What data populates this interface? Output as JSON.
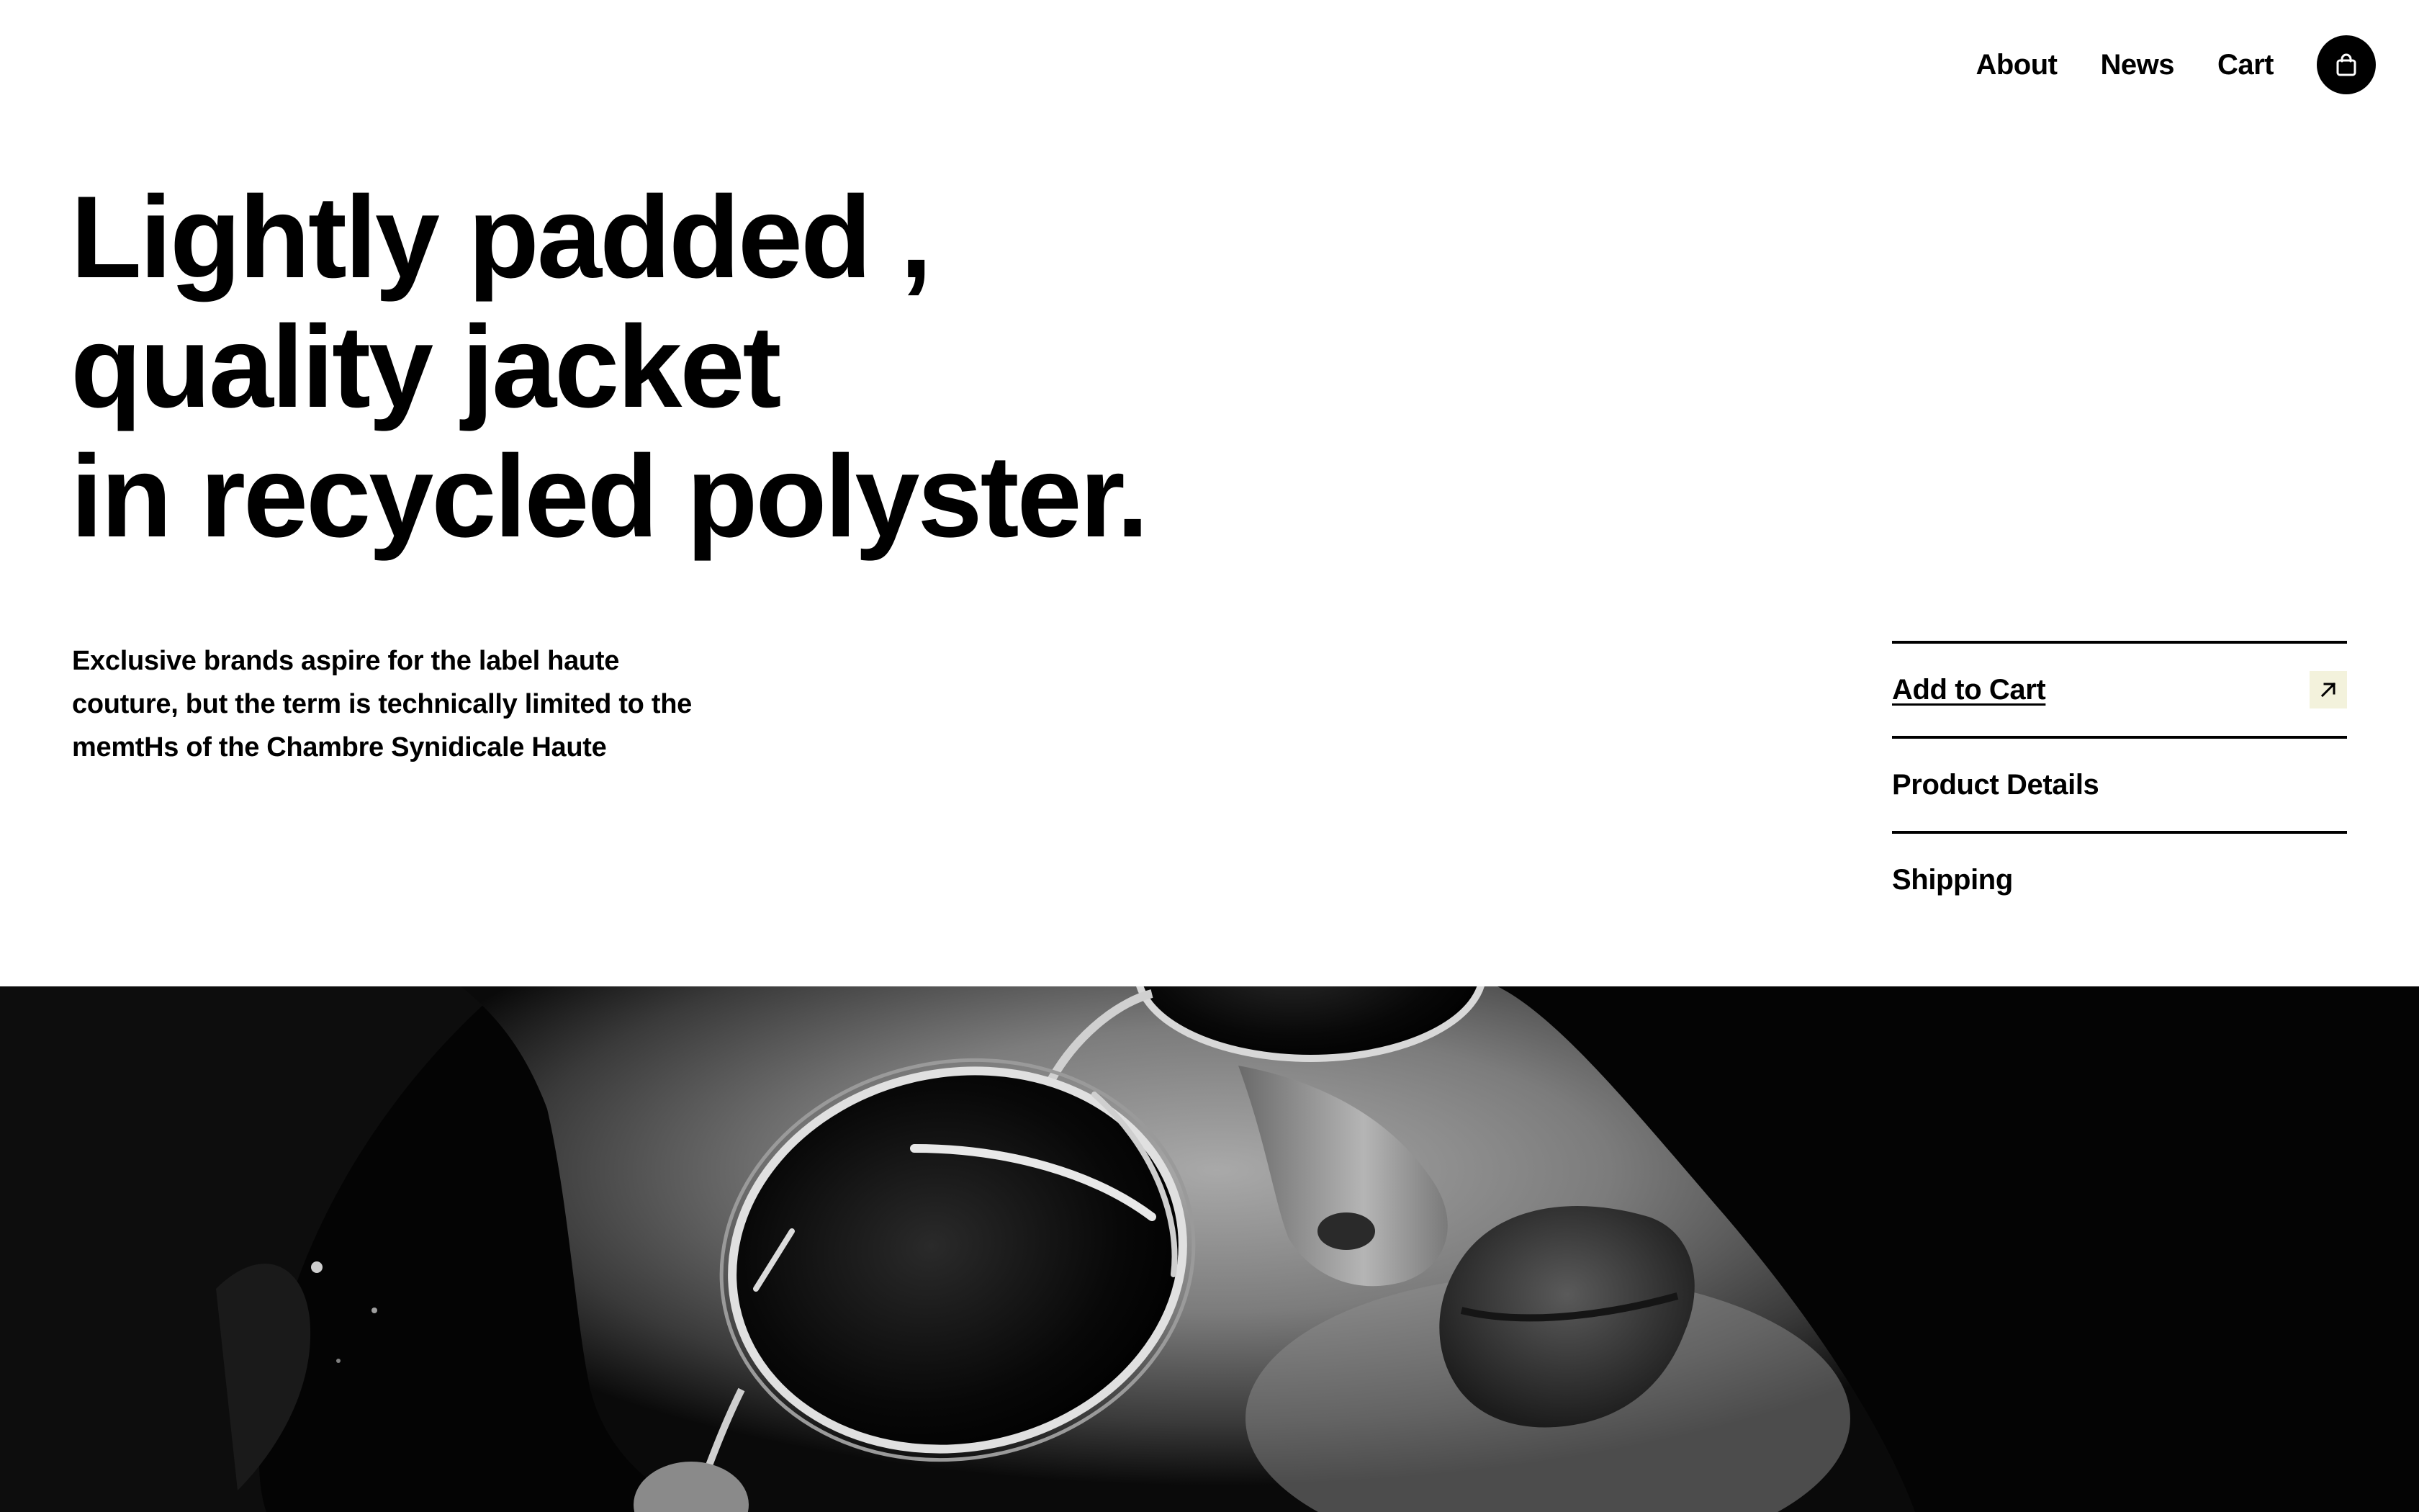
{
  "nav": {
    "links": [
      {
        "label": "About"
      },
      {
        "label": "News"
      },
      {
        "label": "Cart"
      }
    ],
    "cart_icon": "shopping-bag-icon"
  },
  "hero_text": {
    "headline_lines": [
      "Lightly padded ,",
      "quality jacket",
      "in recycled polyster."
    ],
    "description": "Exclusive brands aspire for the label haute couture, but the term is technically limited to the memtHs of the Chambre Synidicale Haute"
  },
  "actions": {
    "items": [
      {
        "label": "Add to Cart",
        "icon": "arrow-up-right-icon"
      },
      {
        "label": "Product Details"
      },
      {
        "label": "Shipping"
      }
    ]
  },
  "colors": {
    "text": "#000000",
    "background": "#ffffff",
    "arrow_box": "#f3f2dc"
  }
}
